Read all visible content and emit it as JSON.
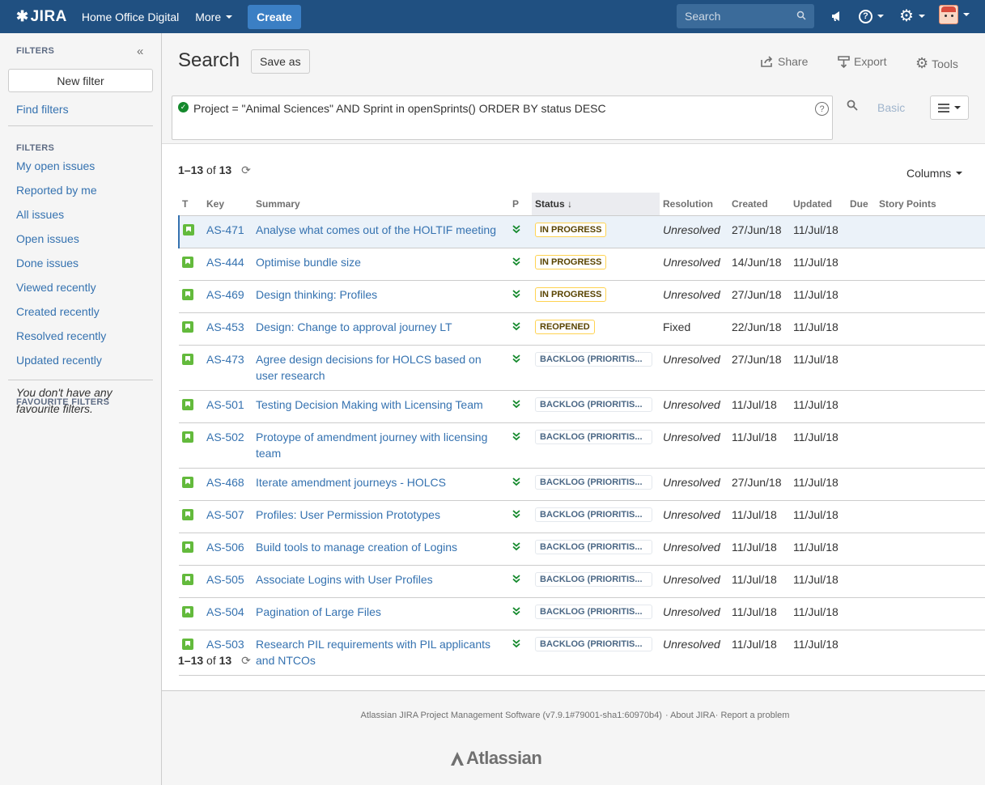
{
  "header": {
    "logo_text": "JIRA",
    "brand": "Home Office Digital",
    "more_label": "More",
    "create_label": "Create",
    "search_placeholder": "Search"
  },
  "sidebar": {
    "filters_heading": "FILTERS",
    "new_filter": "New filter",
    "find_filters": "Find filters",
    "filters_heading2": "FILTERS",
    "items": [
      "My open issues",
      "Reported by me",
      "All issues",
      "Open issues",
      "Done issues",
      "Viewed recently",
      "Created recently",
      "Resolved recently",
      "Updated recently"
    ],
    "favourite_heading": "FAVOURITE FILTERS",
    "favourite_empty": "You don't have any favourite filters."
  },
  "search": {
    "title": "Search",
    "save_as": "Save as",
    "share": "Share",
    "export": "Export",
    "tools": "Tools",
    "jql": "Project = \"Animal Sciences\" AND Sprint in openSprints() ORDER BY status DESC",
    "basic": "Basic"
  },
  "results": {
    "range": "1–13",
    "of": "of",
    "total": "13",
    "columns_label": "Columns",
    "headers": [
      "T",
      "Key",
      "Summary",
      "P",
      "Status",
      "Resolution",
      "Created",
      "Updated",
      "Due",
      "Story Points"
    ],
    "rows": [
      {
        "key": "AS-471",
        "summary": "Analyse what comes out of the HOLTIF meeting",
        "status": "IN PROGRESS",
        "status_type": "prog",
        "resolution": "Unresolved",
        "created": "27/Jun/18",
        "updated": "11/Jul/18"
      },
      {
        "key": "AS-444",
        "summary": "Optimise bundle size",
        "status": "IN PROGRESS",
        "status_type": "prog",
        "resolution": "Unresolved",
        "created": "14/Jun/18",
        "updated": "11/Jul/18"
      },
      {
        "key": "AS-469",
        "summary": "Design thinking: Profiles",
        "status": "IN PROGRESS",
        "status_type": "prog",
        "resolution": "Unresolved",
        "created": "27/Jun/18",
        "updated": "11/Jul/18"
      },
      {
        "key": "AS-453",
        "summary": "Design: Change to approval journey LT",
        "status": "REOPENED",
        "status_type": "reop",
        "resolution": "Fixed",
        "created": "22/Jun/18",
        "updated": "11/Jul/18"
      },
      {
        "key": "AS-473",
        "summary": "Agree design decisions for HOLCS based on user research",
        "status": "BACKLOG (PRIORITIS...",
        "status_type": "back",
        "resolution": "Unresolved",
        "created": "27/Jun/18",
        "updated": "11/Jul/18"
      },
      {
        "key": "AS-501",
        "summary": "Testing Decision Making with Licensing Team",
        "status": "BACKLOG (PRIORITIS...",
        "status_type": "back",
        "resolution": "Unresolved",
        "created": "11/Jul/18",
        "updated": "11/Jul/18"
      },
      {
        "key": "AS-502",
        "summary": "Protoype of amendment journey with licensing team",
        "status": "BACKLOG (PRIORITIS...",
        "status_type": "back",
        "resolution": "Unresolved",
        "created": "11/Jul/18",
        "updated": "11/Jul/18"
      },
      {
        "key": "AS-468",
        "summary": "Iterate amendment journeys - HOLCS",
        "status": "BACKLOG (PRIORITIS...",
        "status_type": "back",
        "resolution": "Unresolved",
        "created": "27/Jun/18",
        "updated": "11/Jul/18"
      },
      {
        "key": "AS-507",
        "summary": "Profiles: User Permission Prototypes",
        "status": "BACKLOG (PRIORITIS...",
        "status_type": "back",
        "resolution": "Unresolved",
        "created": "11/Jul/18",
        "updated": "11/Jul/18"
      },
      {
        "key": "AS-506",
        "summary": "Build tools to manage creation of Logins",
        "status": "BACKLOG (PRIORITIS...",
        "status_type": "back",
        "resolution": "Unresolved",
        "created": "11/Jul/18",
        "updated": "11/Jul/18"
      },
      {
        "key": "AS-505",
        "summary": "Associate Logins with User Profiles",
        "status": "BACKLOG (PRIORITIS...",
        "status_type": "back",
        "resolution": "Unresolved",
        "created": "11/Jul/18",
        "updated": "11/Jul/18"
      },
      {
        "key": "AS-504",
        "summary": "Pagination of Large Files",
        "status": "BACKLOG (PRIORITIS...",
        "status_type": "back",
        "resolution": "Unresolved",
        "created": "11/Jul/18",
        "updated": "11/Jul/18"
      },
      {
        "key": "AS-503",
        "summary": "Research PIL requirements with PIL applicants and NTCOs",
        "status": "BACKLOG (PRIORITIS...",
        "status_type": "back",
        "resolution": "Unresolved",
        "created": "11/Jul/18",
        "updated": "11/Jul/18"
      }
    ]
  },
  "footer": {
    "software": "Atlassian JIRA Project Management Software (v7.9.1#79001-sha1:60970b4)",
    "about": "About JIRA",
    "report": "Report a problem",
    "atlassian": "Atlassian"
  }
}
